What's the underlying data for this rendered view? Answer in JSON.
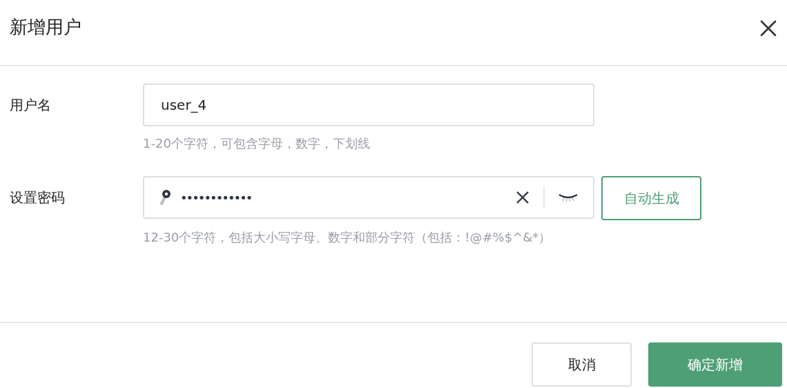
{
  "dialog": {
    "title": "新增用户"
  },
  "fields": [
    {
      "kind": "text",
      "label": "用户名",
      "value": "user_4",
      "hint": "1-20个字符，可包含字母，数字，下划线"
    },
    {
      "kind": "password",
      "label": "设置密码",
      "value": "••••••••••••",
      "hint": "12-30个字符，包括大小写字母、数字和部分字符（包括：!@#%$^&*）",
      "action": "自动生成"
    }
  ],
  "buttons": [
    {
      "label": "取消",
      "kind": "secondary"
    },
    {
      "label": "确定新增",
      "kind": "primary"
    }
  ]
}
